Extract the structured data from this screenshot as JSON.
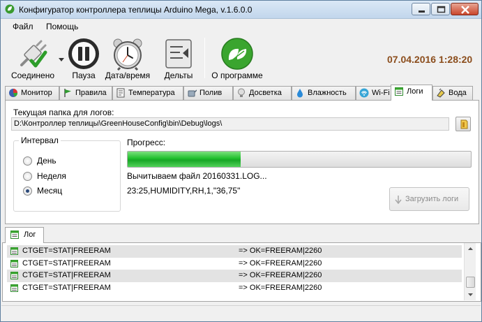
{
  "window": {
    "title": "Конфигуратор контроллера теплицы Arduino Mega, v.1.6.0.0"
  },
  "menu": {
    "items": [
      "Файл",
      "Помощь"
    ]
  },
  "toolbar": {
    "buttons": [
      {
        "label": "Соединено",
        "icon": "plug-connected-icon"
      },
      {
        "label": "Пауза",
        "icon": "pause-icon"
      },
      {
        "label": "Дата/время",
        "icon": "alarm-clock-icon"
      },
      {
        "label": "Дельты",
        "icon": "deltas-icon"
      },
      {
        "label": "О программе",
        "icon": "leaf-icon"
      }
    ],
    "datetime": "07.04.2016 1:28:20"
  },
  "tabs": [
    {
      "label": "Монитор",
      "icon": "monitor-icon"
    },
    {
      "label": "Правила",
      "icon": "flag-icon"
    },
    {
      "label": "Температура",
      "icon": "thermometer-icon"
    },
    {
      "label": "Полив",
      "icon": "watering-icon"
    },
    {
      "label": "Досветка",
      "icon": "bulb-icon"
    },
    {
      "label": "Влажность",
      "icon": "droplet-icon"
    },
    {
      "label": "Wi-Fi",
      "icon": "wifi-icon"
    },
    {
      "label": "Логи",
      "icon": "log-icon",
      "active": true
    },
    {
      "label": "Вода",
      "icon": "water-icon"
    }
  ],
  "logs_tab": {
    "folder_label": "Текущая папка для логов:",
    "folder_path": "D:\\Контроллер теплицы\\GreenHouseConfig\\bin\\Debug\\logs\\",
    "interval_title": "Интервал",
    "intervals": [
      {
        "label": "День",
        "checked": false
      },
      {
        "label": "Неделя",
        "checked": false
      },
      {
        "label": "Месяц",
        "checked": true
      }
    ],
    "progress_label": "Прогресс:",
    "progress_fraction": 0.33,
    "reading_status": "Вычитываем файл 20160331.LOG...",
    "last_line": "23:25,HUMIDITY,RH,1,\"36,75\"",
    "load_button": "Загрузить логи"
  },
  "log_panel": {
    "tab_label": "Лог",
    "rows": [
      {
        "cmd": "CTGET=STAT|FREERAM",
        "resp": "=> OK=FREERAM|2260"
      },
      {
        "cmd": "CTGET=STAT|FREERAM",
        "resp": "=> OK=FREERAM|2260"
      },
      {
        "cmd": "CTGET=STAT|FREERAM",
        "resp": "=> OK=FREERAM|2260"
      },
      {
        "cmd": "CTGET=STAT|FREERAM",
        "resp": "=> OK=FREERAM|2260"
      }
    ]
  },
  "colors": {
    "datetime": "#8b4d1c",
    "progress": "#1fbf2c"
  }
}
